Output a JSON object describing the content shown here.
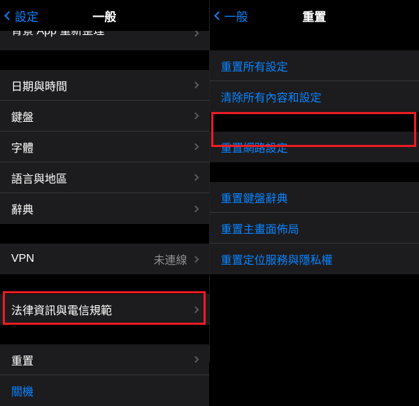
{
  "left": {
    "back": "設定",
    "title": "一般",
    "partial_row": "背景 App 重新整理",
    "group1": [
      {
        "label": "日期與時間"
      },
      {
        "label": "鍵盤"
      },
      {
        "label": "字體"
      },
      {
        "label": "語言與地區"
      },
      {
        "label": "辭典"
      }
    ],
    "vpn": {
      "label": "VPN",
      "detail": "未連線"
    },
    "legal": "法律資訊與電信規範",
    "reset": "重置",
    "shutdown": "關機"
  },
  "right": {
    "back": "一般",
    "title": "重置",
    "group1": [
      "重置所有設定",
      "清除所有內容和設定"
    ],
    "group2": [
      "重置網路設定"
    ],
    "group3": [
      "重置鍵盤辭典",
      "重置主畫面佈局",
      "重置定位服務與隱私權"
    ]
  }
}
